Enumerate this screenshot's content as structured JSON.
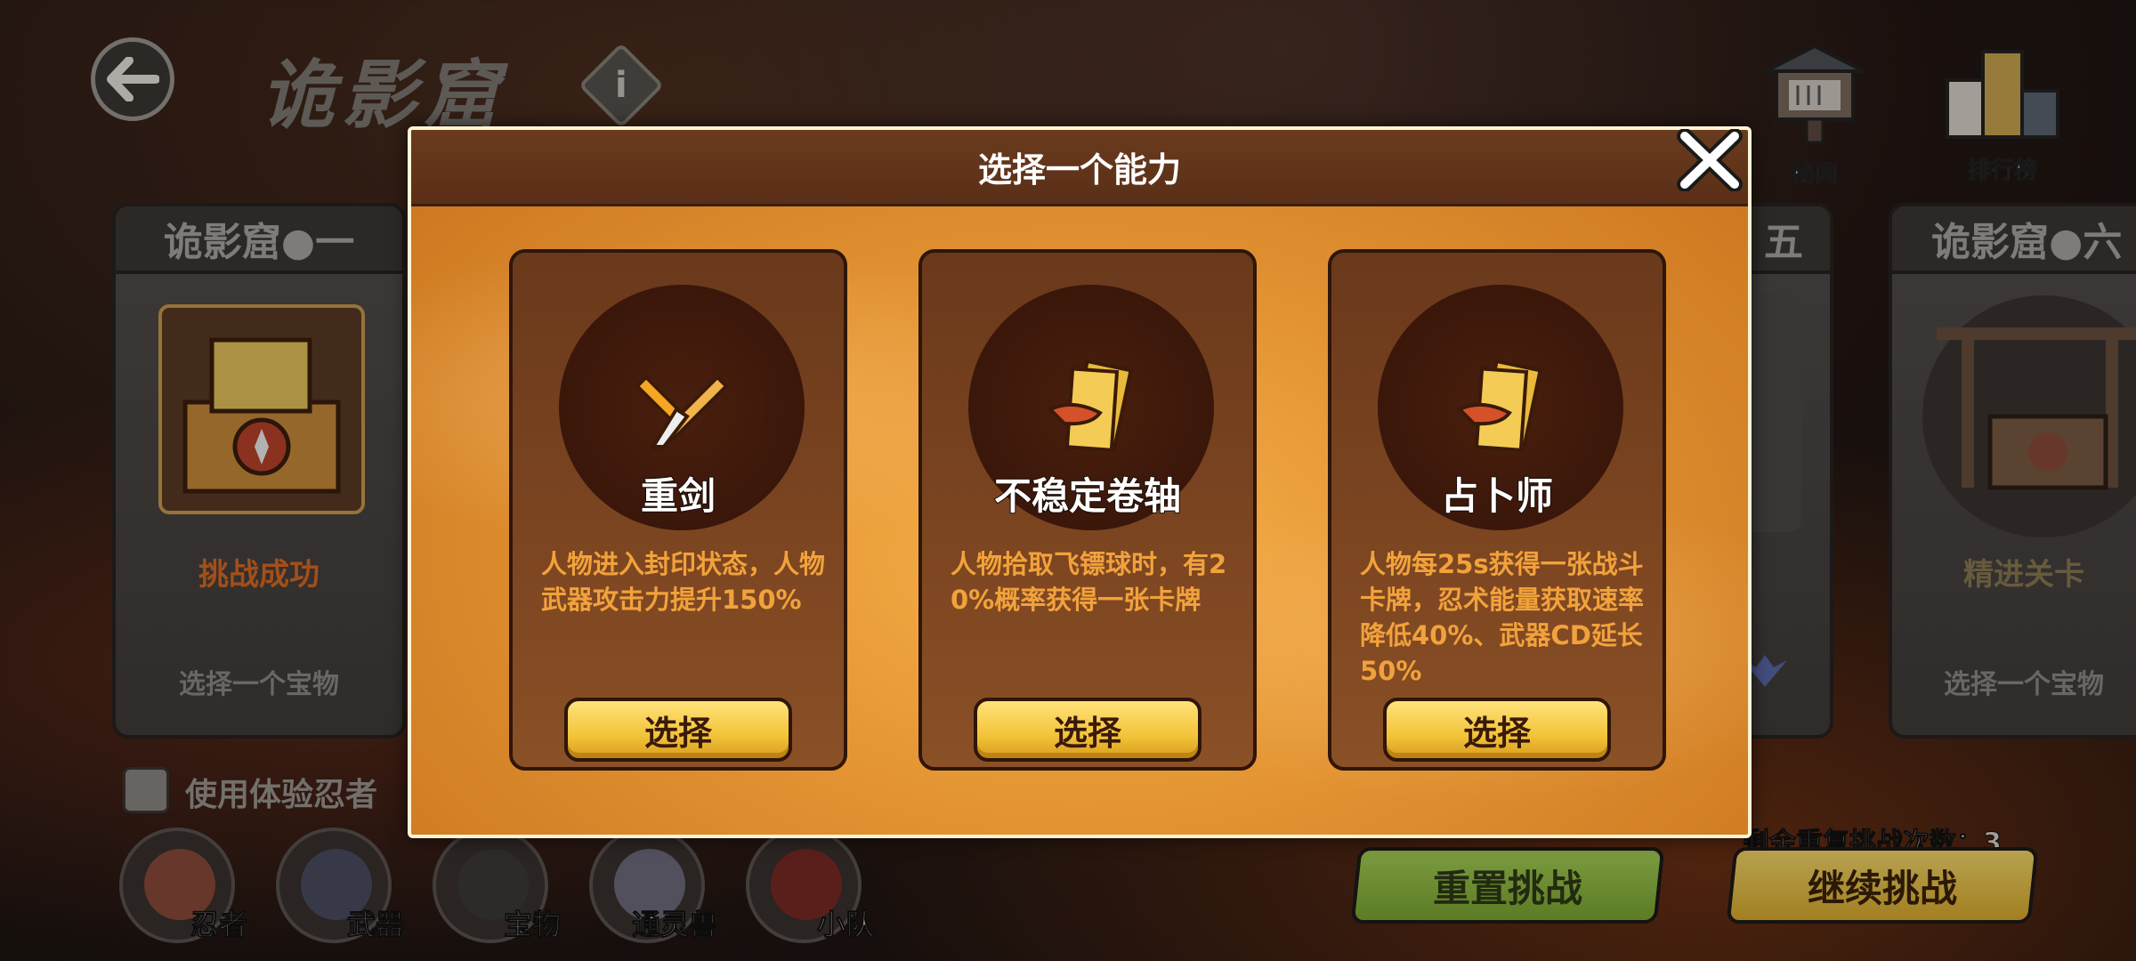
{
  "header": {
    "title": "诡影窟",
    "info_icon": "i",
    "secrets_label": "秘闻",
    "leaderboard_label": "排行榜"
  },
  "levels": [
    {
      "title": "诡影窟●一",
      "status": "挑战成功",
      "subtitle": "选择一个宝物"
    },
    {
      "title": "五"
    },
    {
      "title": "诡影窟●六",
      "status": "精进关卡",
      "subtitle": "选择一个宝物"
    }
  ],
  "trial_ninja": {
    "label": "使用体验忍者"
  },
  "bottom_nav": [
    {
      "label": "忍者",
      "icon": "ninja-icon"
    },
    {
      "label": "武器",
      "icon": "weapon-icon"
    },
    {
      "label": "宝物",
      "icon": "treasure-icon"
    },
    {
      "label": "通灵兽",
      "icon": "summon-beast-icon"
    },
    {
      "label": "小队",
      "icon": "squad-icon"
    }
  ],
  "remaining_retries": "剩余重复挑战次数：3",
  "reset_button": "重置挑战",
  "continue_button": "继续挑战",
  "modal": {
    "title": "选择一个能力",
    "options": [
      {
        "name": "重剑",
        "icon": "heavy-sword-icon",
        "desc": "人物进入封印状态，人物武器攻击力提升150%",
        "button": "选择"
      },
      {
        "name": "不稳定卷轴",
        "icon": "unstable-scroll-icon",
        "desc": "人物拾取飞镖球时，有20%概率获得一张卡牌",
        "button": "选择"
      },
      {
        "name": "占卜师",
        "icon": "diviner-scroll-icon",
        "desc": "人物每25s获得一张战斗卡牌，忍术能量获取速率降低40%、武器CD延长50%",
        "button": "选择"
      }
    ]
  },
  "colors": {
    "modal_orange": "#e39332",
    "card_brown": "#6a391b",
    "desc_orange": "#f2a23b",
    "button_yellow": "#f3c43a",
    "reset_green": "#8fbf3f",
    "continue_yellow": "#e8c04a"
  }
}
